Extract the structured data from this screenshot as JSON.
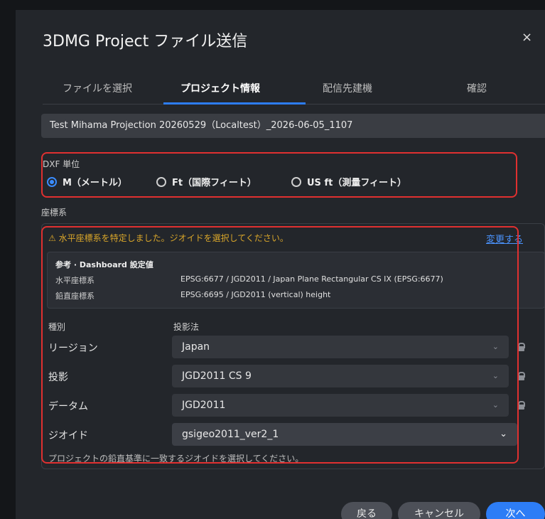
{
  "dialog": {
    "title": "3DMG Project ファイル送信",
    "close": "×"
  },
  "tabs": [
    {
      "label": "ファイルを選択"
    },
    {
      "label": "プロジェクト情報"
    },
    {
      "label": "配信先建機"
    },
    {
      "label": "確認"
    }
  ],
  "project_name": "Test Mihama Projection 20260529（Localtest）_2026-06-05_1107",
  "dxf_unit": {
    "label": "DXF 単位",
    "options": [
      {
        "label": "M（メートル）",
        "checked": true
      },
      {
        "label": "Ft（国際フィート）",
        "checked": false
      },
      {
        "label": "US ft（測量フィート）",
        "checked": false
      }
    ]
  },
  "crs": {
    "label": "座標系",
    "warning": "⚠ 水平座標系を特定しました。ジオイドを選択してください。",
    "change_link": "変更する",
    "reference": {
      "title": "参考 · Dashboard 設定値",
      "horizontal_key": "水平座標系",
      "horizontal_val": "EPSG:6677 / JGD2011 / Japan Plane Rectangular CS IX (EPSG:6677)",
      "vertical_key": "鉛直座標系",
      "vertical_val": "EPSG:6695 / JGD2011 (vertical) height"
    },
    "col_type": "種別",
    "col_projection": "投影法",
    "rows": [
      {
        "label": "リージョン",
        "value": "Japan"
      },
      {
        "label": "投影",
        "value": "JGD2011 CS 9"
      },
      {
        "label": "データム",
        "value": "JGD2011"
      },
      {
        "label": "ジオイド",
        "value": "gsigeo2011_ver2_1"
      }
    ],
    "hint": "プロジェクトの鉛直基準に一致するジオイドを選択してください。"
  },
  "footer": {
    "back": "戻る",
    "cancel": "キャンセル",
    "next": "次へ"
  },
  "colors": {
    "accent": "#2d7df6",
    "warning": "#d9a62a",
    "highlight_border": "#e03030"
  }
}
